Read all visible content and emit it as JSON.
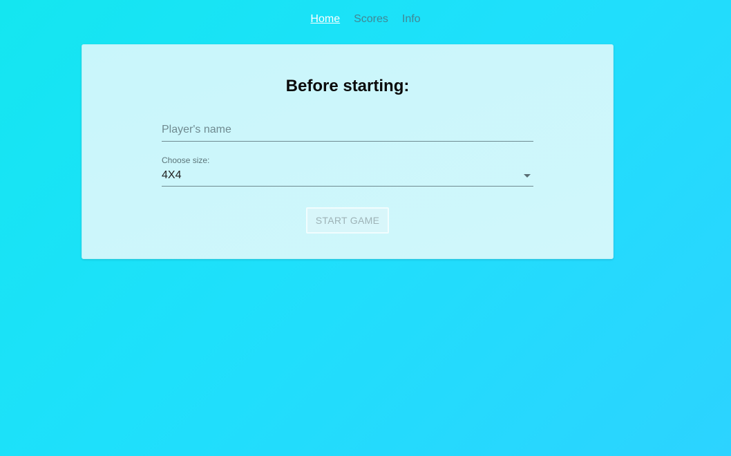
{
  "nav": {
    "items": [
      {
        "label": "Home",
        "active": true
      },
      {
        "label": "Scores",
        "active": false
      },
      {
        "label": "Info",
        "active": false
      }
    ]
  },
  "card": {
    "title": "Before starting:",
    "name_field": {
      "placeholder": "Player's name",
      "value": ""
    },
    "size_field": {
      "label": "Choose size:",
      "selected": "4X4",
      "caret_icon": "dropdown-caret-icon"
    },
    "start_button": {
      "label": "START GAME",
      "disabled": true
    }
  },
  "colors": {
    "background_start": "#14e6f0",
    "background_end": "#2cd3ff",
    "card_background": "#ccf6fb",
    "active_nav": "#ffffff",
    "inactive_nav": "#6b8a92"
  }
}
